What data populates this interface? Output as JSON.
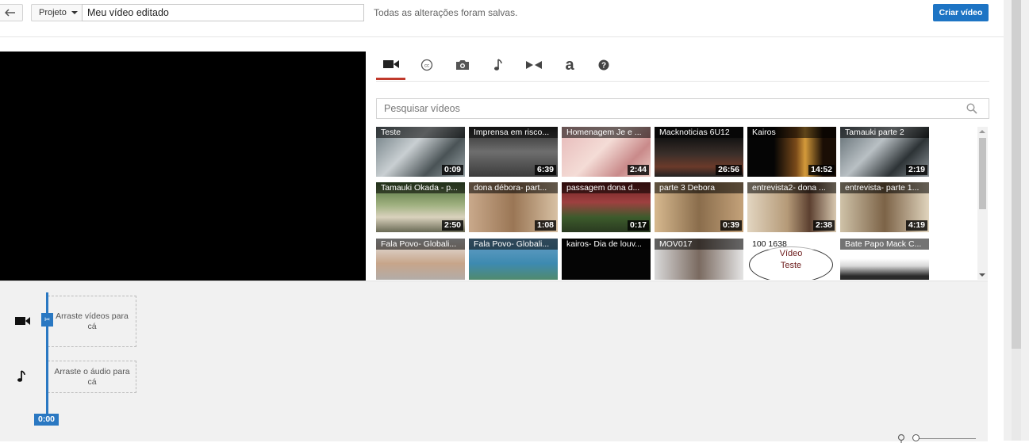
{
  "topbar": {
    "project_label": "Projeto",
    "title_value": "Meu vídeo editado",
    "save_status": "Todas as alterações foram salvas.",
    "create_button": "Criar vídeo",
    "accent_color": "#1d74c4"
  },
  "tabs": [
    {
      "name": "video-camera-icon",
      "active": true
    },
    {
      "name": "cc-icon",
      "active": false
    },
    {
      "name": "camera-icon",
      "active": false
    },
    {
      "name": "music-note-icon",
      "active": false
    },
    {
      "name": "transitions-icon",
      "active": false
    },
    {
      "name": "text-a-icon",
      "active": false
    },
    {
      "name": "help-icon",
      "active": false
    }
  ],
  "search": {
    "placeholder": "Pesquisar vídeos"
  },
  "videos": [
    {
      "title": "Teste",
      "duration": "0:09"
    },
    {
      "title": "Imprensa em risco...",
      "duration": "6:39"
    },
    {
      "title": "Homenagem Je e ...",
      "duration": "2:44"
    },
    {
      "title": "Macknoticias 6U12",
      "duration": "26:56"
    },
    {
      "title": "Kairos",
      "duration": "14:52"
    },
    {
      "title": "Tamauki parte 2",
      "duration": "2:19"
    },
    {
      "title": "Tamauki Okada - p...",
      "duration": "2:50"
    },
    {
      "title": "dona débora- part...",
      "duration": "1:08"
    },
    {
      "title": "passagem dona d...",
      "duration": "0:17"
    },
    {
      "title": "parte 3 Debora",
      "duration": "0:39"
    },
    {
      "title": "entrevista2- dona ...",
      "duration": "2:38"
    },
    {
      "title": "entrevista- parte 1...",
      "duration": "4:19"
    },
    {
      "title": "Fala Povo- Globali...",
      "duration": ""
    },
    {
      "title": "Fala Povo- Globali...",
      "duration": ""
    },
    {
      "title": "kairos- Dia de louv...",
      "duration": ""
    },
    {
      "title": "MOV017",
      "duration": ""
    },
    {
      "title": "100 1638",
      "duration": "",
      "overlay": "Vídeo Teste"
    },
    {
      "title": "Bate Papo Mack C...",
      "duration": ""
    }
  ],
  "timeline": {
    "video_drop": "Arraste vídeos para cá",
    "audio_drop": "Arraste o áudio para cá",
    "current_time": "0:00",
    "playhead_color": "#2a78c2"
  }
}
